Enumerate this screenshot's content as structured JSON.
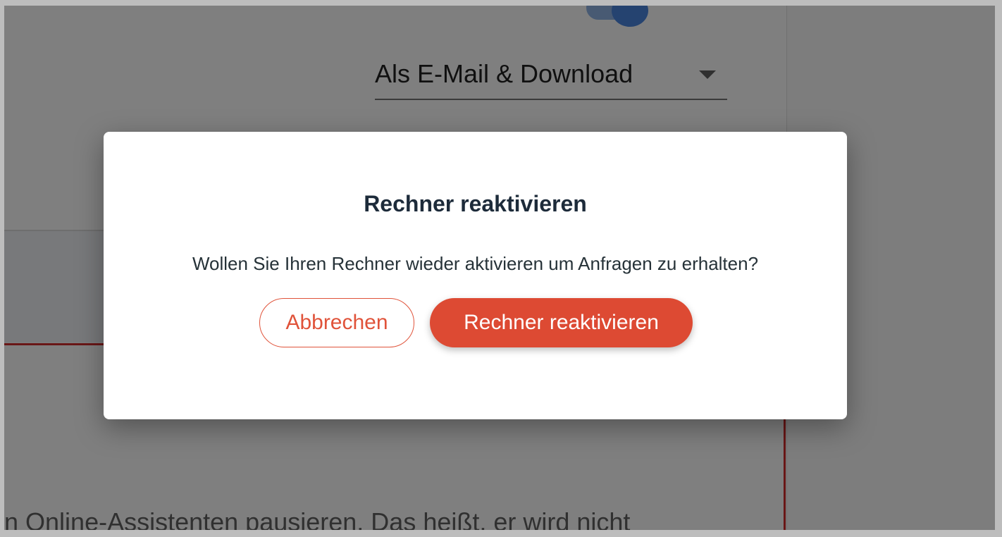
{
  "background": {
    "delivery_select": {
      "value": "Als E-Mail & Download"
    },
    "bottom_text": "n Online-Assistenten pausieren. Das heißt, er wird nicht"
  },
  "dialog": {
    "title": "Rechner reaktivieren",
    "message": "Wollen Sie Ihren Rechner wieder aktivieren um Anfragen zu erhalten?",
    "cancel_label": "Abbrechen",
    "confirm_label": "Rechner reaktivieren"
  },
  "colors": {
    "accent": "#dd4a33",
    "toggle": "#4a87e0",
    "error_line": "#d32f2f"
  }
}
